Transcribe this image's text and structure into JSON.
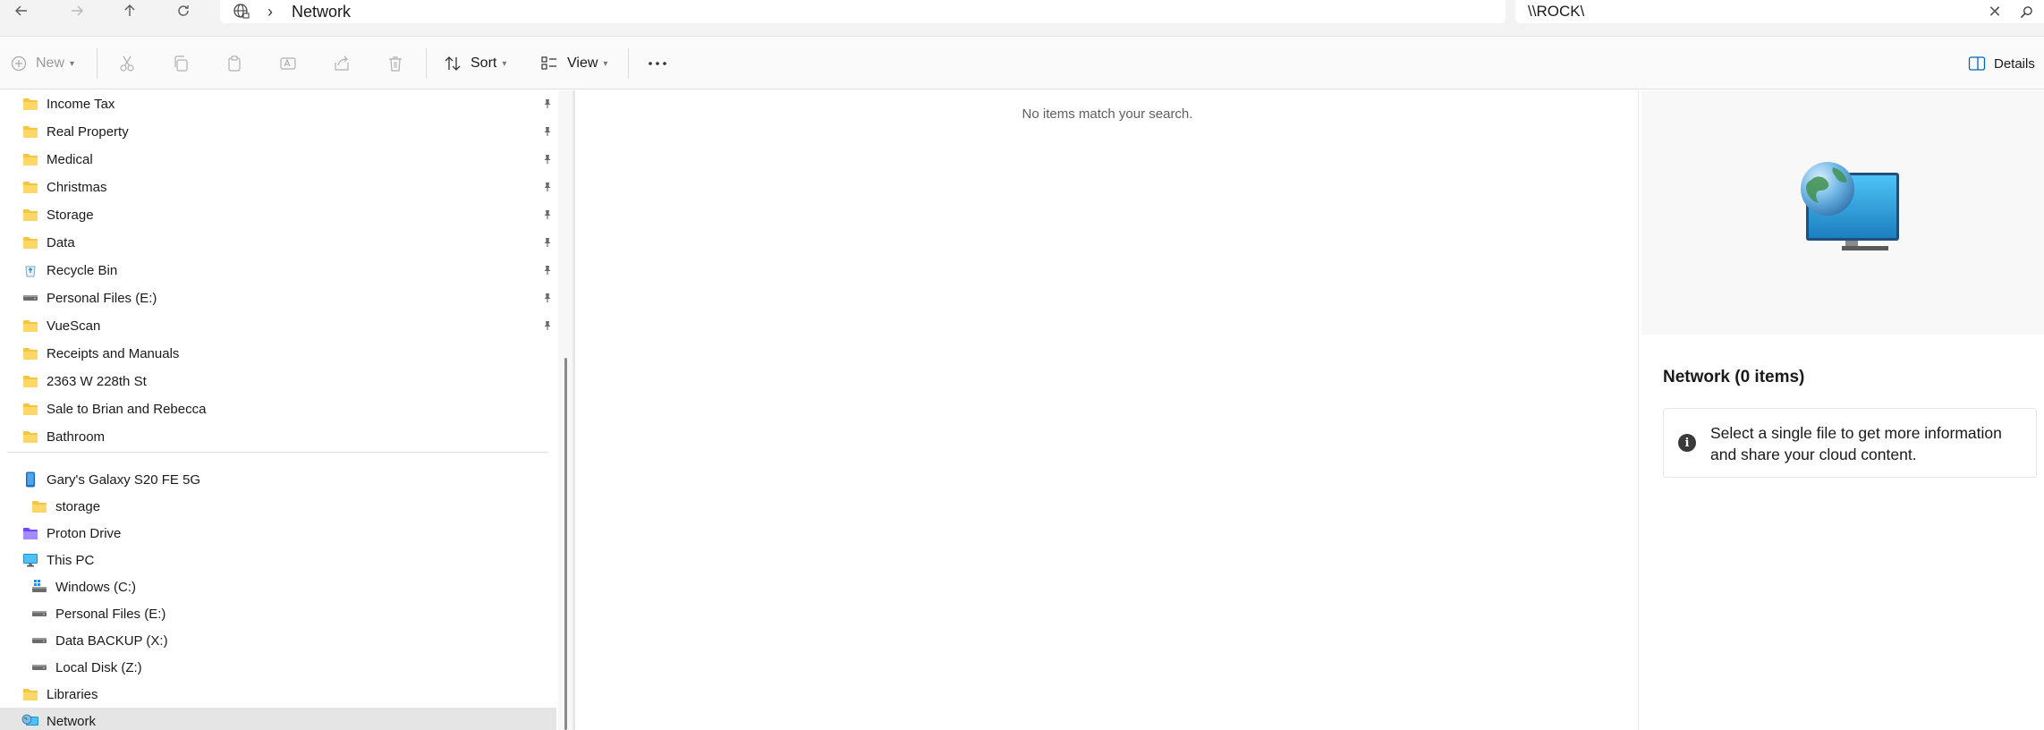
{
  "address_bar": {
    "back_icon": "arrow-left-icon",
    "forward_icon": "arrow-right-icon",
    "up_icon": "arrow-up-icon",
    "refresh_icon": "refresh-icon",
    "location_icon": "network-globe-icon",
    "breadcrumb": [
      "Network"
    ],
    "search_value": "\\\\ROCK\\"
  },
  "toolbar": {
    "new_label": "New",
    "sort_label": "Sort",
    "view_label": "View",
    "details_label": "Details",
    "icons": [
      "cut-icon",
      "copy-icon",
      "paste-icon",
      "rename-icon",
      "share-icon",
      "delete-icon",
      "more-icon"
    ]
  },
  "sidebar": {
    "quick_access": [
      {
        "label": "Income Tax",
        "icon": "folder-icon",
        "pinned": true
      },
      {
        "label": "Real Property",
        "icon": "folder-icon",
        "pinned": true
      },
      {
        "label": "Medical",
        "icon": "folder-icon",
        "pinned": true
      },
      {
        "label": "Christmas",
        "icon": "folder-icon",
        "pinned": true
      },
      {
        "label": "Storage",
        "icon": "folder-icon",
        "pinned": true
      },
      {
        "label": "Data",
        "icon": "folder-icon",
        "pinned": true
      },
      {
        "label": "Recycle Bin",
        "icon": "recycle-bin-icon",
        "pinned": true
      },
      {
        "label": "Personal Files (E:)",
        "icon": "drive-icon",
        "pinned": true
      },
      {
        "label": "VueScan",
        "icon": "folder-icon",
        "pinned": true
      },
      {
        "label": "Receipts and Manuals",
        "icon": "folder-icon",
        "pinned": false
      },
      {
        "label": "2363 W 228th St",
        "icon": "folder-icon",
        "pinned": false
      },
      {
        "label": "Sale to Brian and Rebecca",
        "icon": "folder-icon",
        "pinned": false
      },
      {
        "label": "Bathroom",
        "icon": "folder-icon",
        "pinned": false
      }
    ],
    "devices": [
      {
        "label": "Gary's Galaxy S20 FE 5G",
        "icon": "phone-icon"
      },
      {
        "label": "storage",
        "icon": "folder-icon"
      },
      {
        "label": "Proton Drive",
        "icon": "proton-drive-icon"
      },
      {
        "label": "This PC",
        "icon": "monitor-icon"
      },
      {
        "label": "Windows (C:)",
        "icon": "windows-drive-icon"
      },
      {
        "label": "Personal Files (E:)",
        "icon": "drive-icon"
      },
      {
        "label": "Data BACKUP (X:)",
        "icon": "drive-icon"
      },
      {
        "label": "Local Disk (Z:)",
        "icon": "drive-icon"
      },
      {
        "label": "Libraries",
        "icon": "folder-icon"
      },
      {
        "label": "Network",
        "icon": "network-icon"
      }
    ]
  },
  "content": {
    "empty_message": "No items match your search."
  },
  "details": {
    "preview_icon": "network-globe-monitor-icon",
    "title": "Network (0 items)",
    "info_text": "Select a single file to get more information and share your cloud content."
  },
  "colors": {
    "folder": "#f4c542",
    "selected_row": "#e5e5e5",
    "accent": "#0067c0"
  }
}
